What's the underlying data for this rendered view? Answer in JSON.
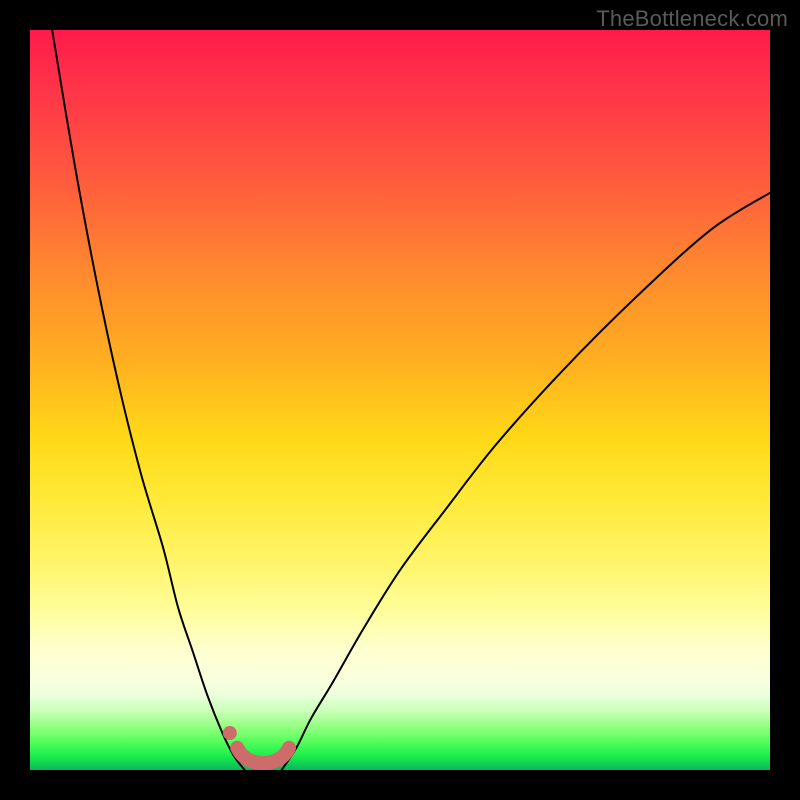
{
  "attribution": "TheBottleneck.com",
  "chart_data": {
    "type": "line",
    "title": "",
    "xlabel": "",
    "ylabel": "",
    "xlim": [
      0,
      100
    ],
    "ylim": [
      0,
      100
    ],
    "series": [
      {
        "name": "left-curve",
        "x": [
          3,
          6,
          9,
          12,
          15,
          18,
          20,
          22,
          24,
          26,
          27.5,
          29
        ],
        "y": [
          100,
          82,
          66,
          52,
          40,
          30,
          22,
          16,
          10,
          5,
          2,
          0
        ]
      },
      {
        "name": "right-curve",
        "x": [
          34,
          36,
          38,
          41,
          45,
          50,
          56,
          63,
          72,
          82,
          92,
          100
        ],
        "y": [
          0,
          3,
          7,
          12,
          19,
          27,
          35,
          44,
          54,
          64,
          73,
          78
        ]
      }
    ],
    "highlight": {
      "flat_segment_x": [
        28,
        35
      ],
      "dot_x": 27,
      "dot_y": 5
    },
    "gradient_stops": [
      {
        "pos": 0,
        "color": "#ff1a4a"
      },
      {
        "pos": 20,
        "color": "#ff5a3e"
      },
      {
        "pos": 45,
        "color": "#ffb020"
      },
      {
        "pos": 72,
        "color": "#fff56a"
      },
      {
        "pos": 90,
        "color": "#e9ffda"
      },
      {
        "pos": 100,
        "color": "#08b85a"
      }
    ]
  }
}
